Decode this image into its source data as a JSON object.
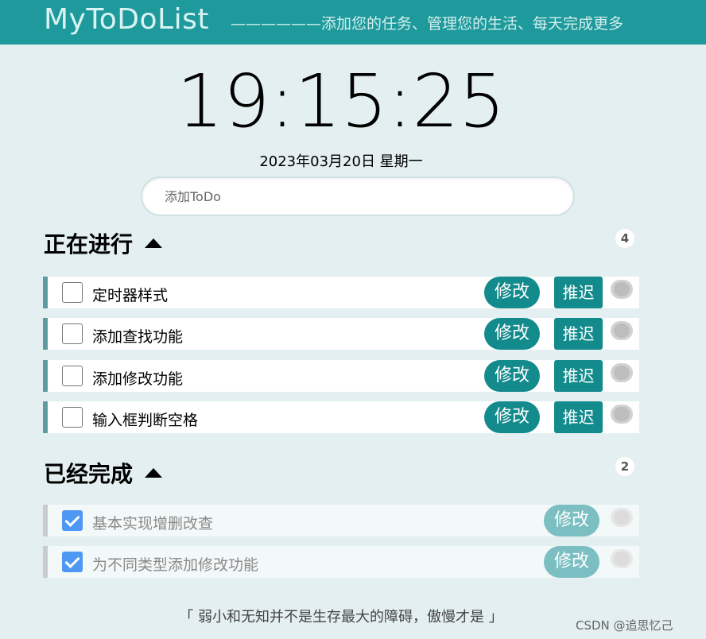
{
  "header": {
    "title": "MyToDoList",
    "slogan": "——————添加您的任务、管理您的生活、每天完成更多"
  },
  "clock": {
    "time": "19:15:25",
    "date": "2023年03月20日 星期一"
  },
  "add_input": {
    "placeholder": "添加ToDo",
    "value": ""
  },
  "in_progress": {
    "title": "正在进行",
    "count": "4",
    "items": [
      {
        "text": "定时器样式",
        "edit_label": "修改",
        "delay_label": "推迟",
        "checked": false
      },
      {
        "text": "添加查找功能",
        "edit_label": "修改",
        "delay_label": "推迟",
        "checked": false
      },
      {
        "text": "添加修改功能",
        "edit_label": "修改",
        "delay_label": "推迟",
        "checked": false
      },
      {
        "text": "输入框判断空格",
        "edit_label": "修改",
        "delay_label": "推迟",
        "checked": false
      }
    ]
  },
  "completed": {
    "title": "已经完成",
    "count": "2",
    "items": [
      {
        "text": "基本实现增删改查",
        "edit_label": "修改",
        "checked": true
      },
      {
        "text": "为不同类型添加修改功能",
        "edit_label": "修改",
        "checked": true
      }
    ]
  },
  "footer": {
    "quote": "「  弱小和无知并不是生存最大的障碍，傲慢才是  」"
  },
  "watermark": "CSDN @追思忆己",
  "colors": {
    "header_bg": "#1f9a9c",
    "button": "#138a8c",
    "page_bg": "#e3eff0",
    "checkbox_checked": "#4e98f4"
  }
}
